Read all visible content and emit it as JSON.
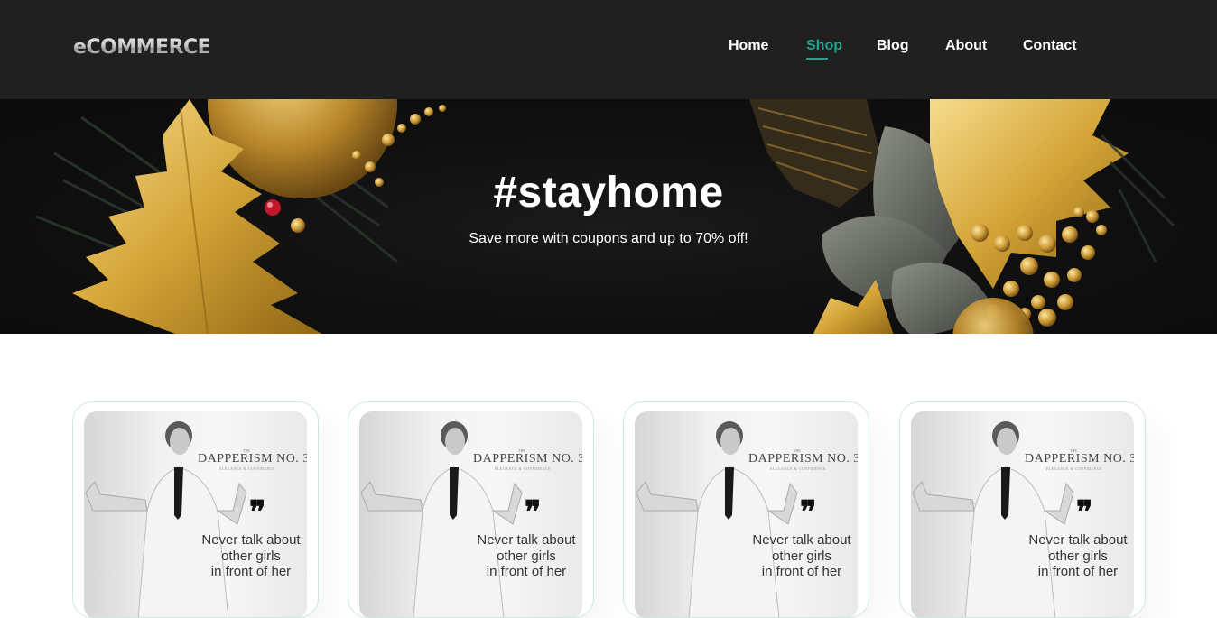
{
  "header": {
    "logo": "eCOMMERCE",
    "nav": [
      {
        "label": "Home",
        "active": false
      },
      {
        "label": "Shop",
        "active": true
      },
      {
        "label": "Blog",
        "active": false
      },
      {
        "label": "About",
        "active": false
      },
      {
        "label": "Contact",
        "active": false
      }
    ],
    "accent_color": "#1fa38a",
    "background_color": "#202020"
  },
  "hero": {
    "title": "#stayhome",
    "subtitle": "Save more with coupons and up to 70% off!",
    "decor_colors": {
      "gold": "#d4a437",
      "leaf": "#5c6159"
    }
  },
  "products": [
    {
      "brand": "DAPPERISM NO. 3",
      "brand_tag": "THE",
      "brand_sub": "ELEGANCE & CONFIDENCE",
      "quote_mark": "❞",
      "quote_lines": [
        "Never talk about",
        "other girls",
        "in front of her"
      ]
    },
    {
      "brand": "DAPPERISM NO. 3",
      "brand_tag": "THE",
      "brand_sub": "ELEGANCE & CONFIDENCE",
      "quote_mark": "❞",
      "quote_lines": [
        "Never talk about",
        "other girls",
        "in front of her"
      ]
    },
    {
      "brand": "DAPPERISM NO. 3",
      "brand_tag": "THE",
      "brand_sub": "ELEGANCE & CONFIDENCE",
      "quote_mark": "❞",
      "quote_lines": [
        "Never talk about",
        "other girls",
        "in front of her"
      ]
    },
    {
      "brand": "DAPPERISM NO. 3",
      "brand_tag": "THE",
      "brand_sub": "ELEGANCE & CONFIDENCE",
      "quote_mark": "❞",
      "quote_lines": [
        "Never talk about",
        "other girls",
        "in front of her"
      ]
    }
  ]
}
